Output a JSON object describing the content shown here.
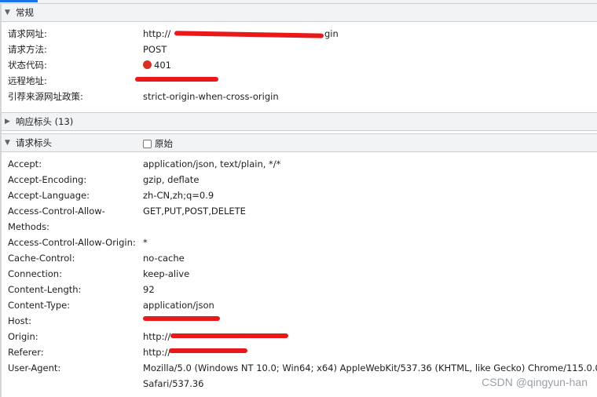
{
  "general": {
    "header": "常规",
    "rows": [
      {
        "key": "请求网址:",
        "value": "http://"
      },
      {
        "key": "请求方法:",
        "value": "POST"
      },
      {
        "key": "状态代码:",
        "value": "401"
      },
      {
        "key": "远程地址:",
        "value": ""
      },
      {
        "key": "引荐来源网址政策:",
        "value": "strict-origin-when-cross-origin"
      }
    ],
    "request_url_tail": "gin"
  },
  "response_headers": {
    "header": "响应标头 (13)"
  },
  "request_headers": {
    "header": "请求标头",
    "raw_label": "原始",
    "rows": [
      {
        "key": "Accept:",
        "value": "application/json, text/plain, */*"
      },
      {
        "key": "Accept-Encoding:",
        "value": "gzip, deflate"
      },
      {
        "key": "Accept-Language:",
        "value": "zh-CN,zh;q=0.9"
      },
      {
        "key": "Access-Control-Allow-",
        "value": "GET,PUT,POST,DELETE"
      },
      {
        "key": "Methods:",
        "value": ""
      },
      {
        "key": "Access-Control-Allow-Origin:",
        "value": "*"
      },
      {
        "key": "Cache-Control:",
        "value": "no-cache"
      },
      {
        "key": "Connection:",
        "value": "keep-alive"
      },
      {
        "key": "Content-Length:",
        "value": "92"
      },
      {
        "key": "Content-Type:",
        "value": "application/json"
      },
      {
        "key": "Host:",
        "value": ""
      },
      {
        "key": "Origin:",
        "value": "http://"
      },
      {
        "key": "Referer:",
        "value": "http://"
      },
      {
        "key": "User-Agent:",
        "value": "Mozilla/5.0 (Windows NT 10.0; Win64; x64) AppleWebKit/537.36 (KHTML, like Gecko) Chrome/115.0.0.0"
      },
      {
        "key": "",
        "value": "Safari/537.36"
      }
    ]
  },
  "watermark": "CSDN @qingyun-han",
  "colors": {
    "status_dot": "#d93025",
    "redaction": "#e8191b",
    "accent": "#1a73e8"
  }
}
